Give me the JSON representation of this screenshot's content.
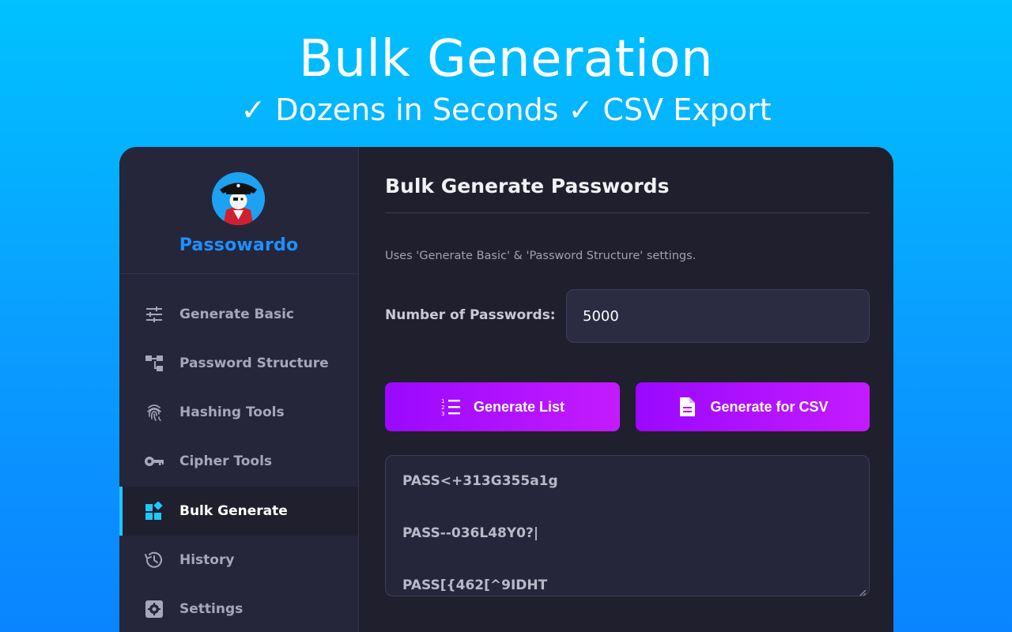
{
  "hero": {
    "title": "Bulk Generation",
    "subtitle": "✓ Dozens in Seconds ✓ CSV Export"
  },
  "brand": {
    "name": "Passowardo"
  },
  "sidebar": {
    "items": [
      {
        "label": "Generate Basic",
        "icon": "sliders-icon",
        "active": false
      },
      {
        "label": "Password Structure",
        "icon": "structure-icon",
        "active": false
      },
      {
        "label": "Hashing Tools",
        "icon": "fingerprint-icon",
        "active": false
      },
      {
        "label": "Cipher Tools",
        "icon": "key-icon",
        "active": false
      },
      {
        "label": "Bulk Generate",
        "icon": "widgets-icon",
        "active": true
      },
      {
        "label": "History",
        "icon": "history-icon",
        "active": false
      },
      {
        "label": "Settings",
        "icon": "settings-icon",
        "active": false
      }
    ]
  },
  "main": {
    "title": "Bulk Generate Passwords",
    "hint": "Uses 'Generate Basic' & 'Password Structure' settings.",
    "count_label": "Number of Passwords:",
    "count_value": "5000",
    "generate_list_label": "Generate List",
    "generate_csv_label": "Generate for CSV",
    "output_lines": [
      "PASS<+313G355a1g",
      "PASS--036L48Y0?|",
      "PASS[{462[^9IDHT"
    ]
  },
  "colors": {
    "accent": "#1ec8ff",
    "brand": "#1e90ff",
    "button_start": "#9a08ff",
    "button_end": "#c41bff"
  }
}
